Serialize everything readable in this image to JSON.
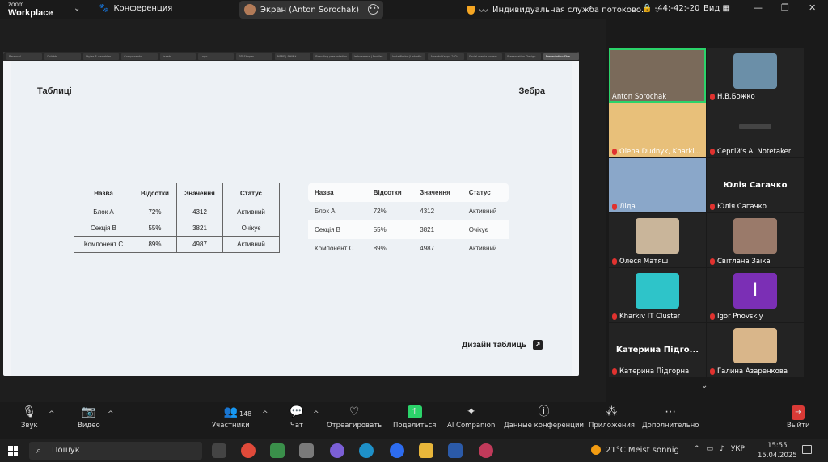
{
  "app": {
    "brand_top": "zoom",
    "brand_bottom": "Workplace",
    "meeting_label": "Конференция"
  },
  "titlebar": {
    "screen_pill": "Экран (Anton Sorochak)",
    "service": "Индивидуальная служба потоково...",
    "timer": "-44:-42:-20",
    "view_label": "Вид"
  },
  "browser_tabs": [
    "Personal",
    "Dribbb",
    "Styles & variables",
    "Components",
    "Assets",
    "Logo",
    "3D Shapes",
    "NERF | SHM *",
    "Branding presentation",
    "Imboamerx | Profiles",
    "InstaWorks (LinkedIn",
    "Awards Kappa 2024",
    "Social media covers",
    "Presentation Design",
    "Presentation Stre"
  ],
  "slide": {
    "title": "Таблиці",
    "zebra_label": "Зебра",
    "design_link": "Дизайн таблиць",
    "table_headers": [
      "Назва",
      "Відсотки",
      "Значення",
      "Статус"
    ],
    "rows": [
      [
        "Блок А",
        "72%",
        "4312",
        "Активний"
      ],
      [
        "Секція В",
        "55%",
        "3821",
        "Очікує"
      ],
      [
        "Компонент С",
        "89%",
        "4987",
        "Активний"
      ]
    ]
  },
  "participants": [
    {
      "name": "Anton Sorochak",
      "color": "#7a6a5a",
      "kind": "video",
      "muted": false
    },
    {
      "name": "Н.В.Божко",
      "color": "#6b8fa8",
      "kind": "photo",
      "muted": true
    },
    {
      "name": "Olena Dudnyk, Kharki...",
      "color": "#e8c07a",
      "kind": "video",
      "muted": true
    },
    {
      "name": "Сергій's AI Notetaker",
      "color": "#1c1c1c",
      "kind": "notetaker",
      "muted": true
    },
    {
      "name": "Ліда",
      "color": "#8aa7c9",
      "kind": "video",
      "muted": true
    },
    {
      "name": "Юлія Сагачко",
      "big": "Юлія Сагачко",
      "color": "#232323",
      "kind": "text",
      "muted": true
    },
    {
      "name": "Олеся Матяш",
      "color": "#c9b59a",
      "kind": "photo",
      "muted": true
    },
    {
      "name": "Світлана Заїка",
      "color": "#9a7a6a",
      "kind": "photo",
      "muted": true
    },
    {
      "name": "Kharkiv IT Cluster",
      "color": "#2ec4c9",
      "kind": "photo",
      "muted": true
    },
    {
      "name": "Igor Pnovskiy",
      "big": "I",
      "color": "#7b2fb5",
      "kind": "letter",
      "muted": true
    },
    {
      "name": "Катерина Підгорна",
      "big": "Катерина Підго...",
      "color": "#232323",
      "kind": "text",
      "muted": true
    },
    {
      "name": "Галина Азаренкова",
      "color": "#d9b68a",
      "kind": "photo",
      "muted": true
    }
  ],
  "toolbar": {
    "sound": "Звук",
    "video": "Видео",
    "participants": "Участники",
    "participants_count": "148",
    "chat": "Чат",
    "react": "Отреагировать",
    "share": "Поделиться",
    "ai": "AI Companion",
    "data": "Данные конференции",
    "apps": "Приложения",
    "more": "Дополнительно",
    "exit": "Выйти"
  },
  "taskbar": {
    "search": "Пошук",
    "weather": "21°C  Meist sonnig",
    "lang": "УКР",
    "time": "15:55",
    "date": "15.04.2025"
  },
  "colors": {
    "accent_green": "#2bd36a",
    "mute_red": "#e0322f"
  }
}
